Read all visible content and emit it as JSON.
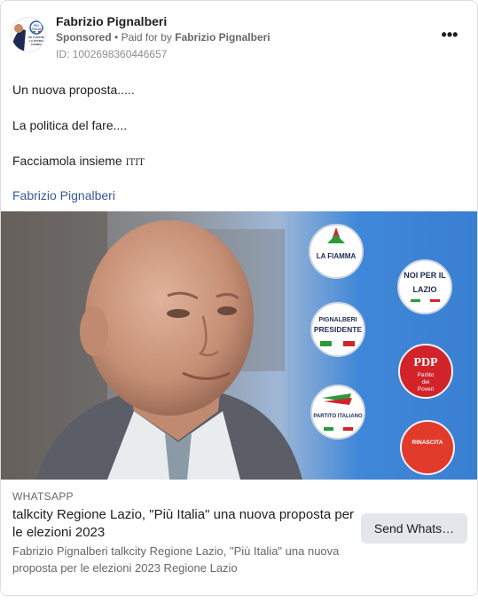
{
  "post": {
    "page_name": "Fabrizio Pignalberi",
    "sponsored_label": "Sponsored",
    "separator": "•",
    "paid_for_prefix": "Paid for by",
    "paid_for_name": "Fabrizio Pignalberi",
    "ad_id": "ID: 1002698360446657",
    "more_icon": "more-horizontal-icon",
    "more_label": "•••",
    "avatar_text": [
      "PIÙ",
      "ITALIA",
      "SE TI AFFIDI",
      "LA STORIA",
      "CAMBIA"
    ],
    "lines": [
      "Un nuova proposta.....",
      "La politica del fare....",
      "Facciamola insieme",
      "Fabrizio Pignalberi"
    ],
    "inline_flag_glyph": "ITIT"
  },
  "image": {
    "logos": {
      "fiamma": "LA FIAMMA",
      "noi_per_lazio_1": "NOI PER IL",
      "noi_per_lazio_2": "LAZIO",
      "pignalberi_1": "PIGNALBERI",
      "pignalberi_2": "PRESIDENTE",
      "pdp_1": "PDP",
      "pdp_2": "Partito",
      "pdp_3": "dei",
      "pdp_4": "Poveri",
      "partito_italiano": "PARTITO ITALIANO",
      "rinascita": "RINASCITA"
    }
  },
  "link_preview": {
    "domain": "WHATSAPP",
    "headline": "talkcity Regione Lazio, \"Più Italia\" una nuova proposta per le elezioni 2023",
    "description": "Fabrizio Pignalberi talkcity Regione Lazio, \"Più Italia\" una nuova proposta per le elezioni 2023 Regione Lazio",
    "cta_label": "Send Whats…"
  }
}
